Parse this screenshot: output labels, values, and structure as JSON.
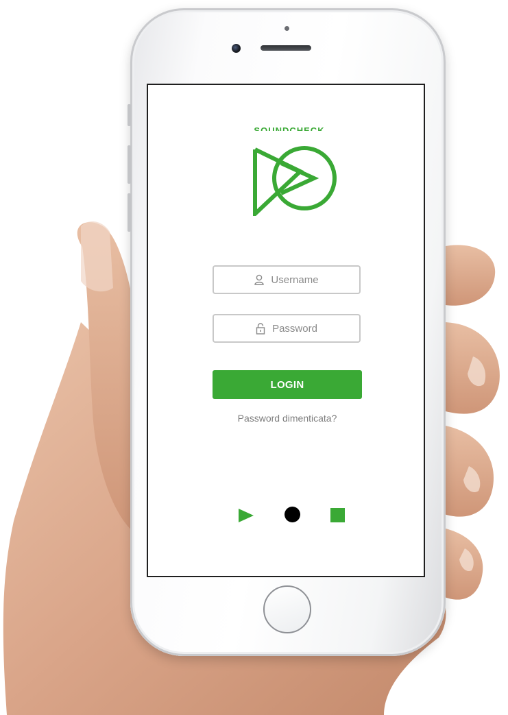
{
  "app": {
    "logo_text": "SOUNDCHECK",
    "brand_color": "#3aa935",
    "logo_icon": "play-circle-logo-icon"
  },
  "login_form": {
    "username_placeholder": "Username",
    "username_icon": "user-icon",
    "password_placeholder": "Password",
    "password_icon": "lock-icon",
    "login_label": "LOGIN",
    "forgot_label": "Password dimenticata?"
  },
  "controls": {
    "play_icon": "play-icon",
    "record_icon": "record-icon",
    "stop_icon": "stop-icon"
  }
}
